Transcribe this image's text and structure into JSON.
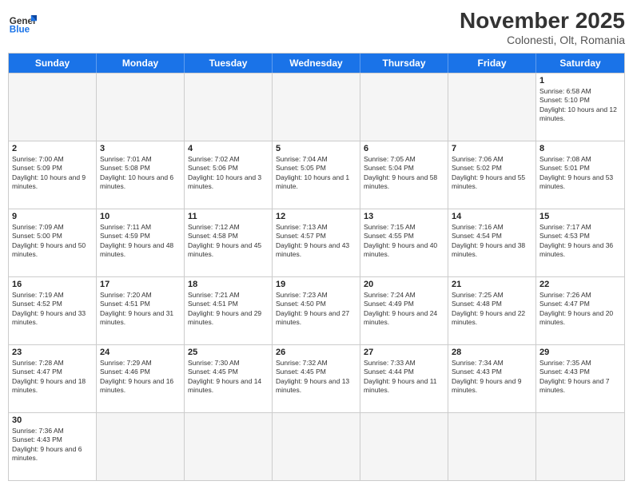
{
  "header": {
    "logo_general": "General",
    "logo_blue": "Blue",
    "month_title": "November 2025",
    "subtitle": "Colonesti, Olt, Romania"
  },
  "weekdays": [
    "Sunday",
    "Monday",
    "Tuesday",
    "Wednesday",
    "Thursday",
    "Friday",
    "Saturday"
  ],
  "rows": [
    [
      {
        "day": "",
        "info": "",
        "empty": true
      },
      {
        "day": "",
        "info": "",
        "empty": true
      },
      {
        "day": "",
        "info": "",
        "empty": true
      },
      {
        "day": "",
        "info": "",
        "empty": true
      },
      {
        "day": "",
        "info": "",
        "empty": true
      },
      {
        "day": "",
        "info": "",
        "empty": true
      },
      {
        "day": "1",
        "info": "Sunrise: 6:58 AM\nSunset: 5:10 PM\nDaylight: 10 hours and 12 minutes."
      }
    ],
    [
      {
        "day": "2",
        "info": "Sunrise: 7:00 AM\nSunset: 5:09 PM\nDaylight: 10 hours and 9 minutes."
      },
      {
        "day": "3",
        "info": "Sunrise: 7:01 AM\nSunset: 5:08 PM\nDaylight: 10 hours and 6 minutes."
      },
      {
        "day": "4",
        "info": "Sunrise: 7:02 AM\nSunset: 5:06 PM\nDaylight: 10 hours and 3 minutes."
      },
      {
        "day": "5",
        "info": "Sunrise: 7:04 AM\nSunset: 5:05 PM\nDaylight: 10 hours and 1 minute."
      },
      {
        "day": "6",
        "info": "Sunrise: 7:05 AM\nSunset: 5:04 PM\nDaylight: 9 hours and 58 minutes."
      },
      {
        "day": "7",
        "info": "Sunrise: 7:06 AM\nSunset: 5:02 PM\nDaylight: 9 hours and 55 minutes."
      },
      {
        "day": "8",
        "info": "Sunrise: 7:08 AM\nSunset: 5:01 PM\nDaylight: 9 hours and 53 minutes."
      }
    ],
    [
      {
        "day": "9",
        "info": "Sunrise: 7:09 AM\nSunset: 5:00 PM\nDaylight: 9 hours and 50 minutes."
      },
      {
        "day": "10",
        "info": "Sunrise: 7:11 AM\nSunset: 4:59 PM\nDaylight: 9 hours and 48 minutes."
      },
      {
        "day": "11",
        "info": "Sunrise: 7:12 AM\nSunset: 4:58 PM\nDaylight: 9 hours and 45 minutes."
      },
      {
        "day": "12",
        "info": "Sunrise: 7:13 AM\nSunset: 4:57 PM\nDaylight: 9 hours and 43 minutes."
      },
      {
        "day": "13",
        "info": "Sunrise: 7:15 AM\nSunset: 4:55 PM\nDaylight: 9 hours and 40 minutes."
      },
      {
        "day": "14",
        "info": "Sunrise: 7:16 AM\nSunset: 4:54 PM\nDaylight: 9 hours and 38 minutes."
      },
      {
        "day": "15",
        "info": "Sunrise: 7:17 AM\nSunset: 4:53 PM\nDaylight: 9 hours and 36 minutes."
      }
    ],
    [
      {
        "day": "16",
        "info": "Sunrise: 7:19 AM\nSunset: 4:52 PM\nDaylight: 9 hours and 33 minutes."
      },
      {
        "day": "17",
        "info": "Sunrise: 7:20 AM\nSunset: 4:51 PM\nDaylight: 9 hours and 31 minutes."
      },
      {
        "day": "18",
        "info": "Sunrise: 7:21 AM\nSunset: 4:51 PM\nDaylight: 9 hours and 29 minutes."
      },
      {
        "day": "19",
        "info": "Sunrise: 7:23 AM\nSunset: 4:50 PM\nDaylight: 9 hours and 27 minutes."
      },
      {
        "day": "20",
        "info": "Sunrise: 7:24 AM\nSunset: 4:49 PM\nDaylight: 9 hours and 24 minutes."
      },
      {
        "day": "21",
        "info": "Sunrise: 7:25 AM\nSunset: 4:48 PM\nDaylight: 9 hours and 22 minutes."
      },
      {
        "day": "22",
        "info": "Sunrise: 7:26 AM\nSunset: 4:47 PM\nDaylight: 9 hours and 20 minutes."
      }
    ],
    [
      {
        "day": "23",
        "info": "Sunrise: 7:28 AM\nSunset: 4:47 PM\nDaylight: 9 hours and 18 minutes."
      },
      {
        "day": "24",
        "info": "Sunrise: 7:29 AM\nSunset: 4:46 PM\nDaylight: 9 hours and 16 minutes."
      },
      {
        "day": "25",
        "info": "Sunrise: 7:30 AM\nSunset: 4:45 PM\nDaylight: 9 hours and 14 minutes."
      },
      {
        "day": "26",
        "info": "Sunrise: 7:32 AM\nSunset: 4:45 PM\nDaylight: 9 hours and 13 minutes."
      },
      {
        "day": "27",
        "info": "Sunrise: 7:33 AM\nSunset: 4:44 PM\nDaylight: 9 hours and 11 minutes."
      },
      {
        "day": "28",
        "info": "Sunrise: 7:34 AM\nSunset: 4:43 PM\nDaylight: 9 hours and 9 minutes."
      },
      {
        "day": "29",
        "info": "Sunrise: 7:35 AM\nSunset: 4:43 PM\nDaylight: 9 hours and 7 minutes."
      }
    ],
    [
      {
        "day": "30",
        "info": "Sunrise: 7:36 AM\nSunset: 4:43 PM\nDaylight: 9 hours and 6 minutes."
      },
      {
        "day": "",
        "info": "",
        "empty": true
      },
      {
        "day": "",
        "info": "",
        "empty": true
      },
      {
        "day": "",
        "info": "",
        "empty": true
      },
      {
        "day": "",
        "info": "",
        "empty": true
      },
      {
        "day": "",
        "info": "",
        "empty": true
      },
      {
        "day": "",
        "info": "",
        "empty": true
      }
    ]
  ]
}
